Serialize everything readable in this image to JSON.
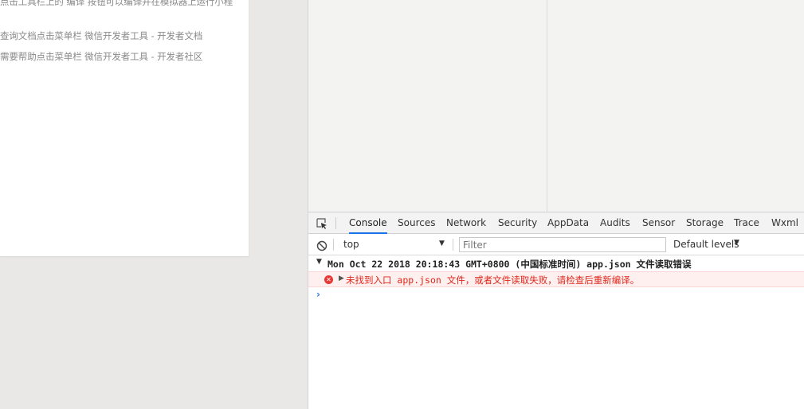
{
  "simulator": {
    "lines": [
      "点击工具栏上的 编译 按钮可以编译并在模拟器上运行小程",
      "查询文档点击菜单栏 微信开发者工具 - 开发者文档",
      "需要帮助点击菜单栏 微信开发者工具 - 开发者社区"
    ]
  },
  "devtools": {
    "tabs": [
      "Console",
      "Sources",
      "Network",
      "Security",
      "AppData",
      "Audits",
      "Sensor",
      "Storage",
      "Trace",
      "Wxml"
    ],
    "active_tab": "Console",
    "filterbar": {
      "context": "top",
      "filter_placeholder": "Filter",
      "filter_value": "",
      "levels": "Default levels"
    },
    "console": {
      "group_header": "Mon Oct 22 2018 20:18:43 GMT+0800 (中国标准时间) app.json 文件读取错误",
      "error_message": "未找到入口 app.json 文件，或者文件读取失败，请检查后重新编译。",
      "prompt_symbol": "›"
    }
  },
  "colors": {
    "accent": "#1a73e8",
    "error_text": "#e0261a",
    "error_bg": "#fff0f0",
    "prompt": "#2a7de1"
  },
  "icons": {
    "inspect": "inspect-element-icon",
    "clear": "clear-console-icon",
    "error": "error-circle-icon",
    "dropdown": "chevron-down-icon"
  }
}
